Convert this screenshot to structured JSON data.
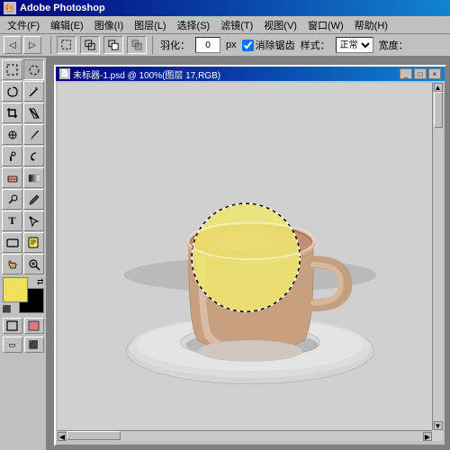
{
  "titlebar": {
    "label": "Adobe Photoshop",
    "icon": "🎨"
  },
  "menubar": {
    "items": [
      {
        "label": "文件(F)"
      },
      {
        "label": "编辑(E)"
      },
      {
        "label": "图像(I)"
      },
      {
        "label": "图层(L)"
      },
      {
        "label": "选择(S)"
      },
      {
        "label": "滤镜(T)"
      },
      {
        "label": "视图(V)"
      },
      {
        "label": "窗口(W)"
      },
      {
        "label": "帮助(H)"
      }
    ]
  },
  "optionsbar": {
    "feather_label": "羽化：",
    "feather_value": "0",
    "feather_unit": "px",
    "antialias_label": "消除锯齿",
    "style_label": "样式：",
    "style_value": "正常",
    "width_label": "宽度："
  },
  "docwindow": {
    "title": "未标器-1.psd @ 100%(图层 17,RGB)"
  },
  "tools": [
    {
      "icon": "▭",
      "name": "rectangular-marquee"
    },
    {
      "icon": "◌",
      "name": "elliptical-marquee"
    },
    {
      "icon": "⟜",
      "name": "lasso"
    },
    {
      "icon": "⊹",
      "name": "magic-wand"
    },
    {
      "icon": "✂",
      "name": "crop"
    },
    {
      "icon": "✒",
      "name": "slice"
    },
    {
      "icon": "⌫",
      "name": "healing"
    },
    {
      "icon": "🖌",
      "name": "brush"
    },
    {
      "icon": "◫",
      "name": "clone-stamp"
    },
    {
      "icon": "◩",
      "name": "history-brush"
    },
    {
      "icon": "◻",
      "name": "eraser"
    },
    {
      "icon": "🪣",
      "name": "gradient"
    },
    {
      "icon": "⬟",
      "name": "dodge"
    },
    {
      "icon": "✎",
      "name": "pen"
    },
    {
      "icon": "T",
      "name": "type"
    },
    {
      "icon": "🔲",
      "name": "path-selection"
    },
    {
      "icon": "⬡",
      "name": "shape"
    },
    {
      "icon": "🔍",
      "name": "zoom"
    },
    {
      "icon": "✋",
      "name": "hand"
    },
    {
      "icon": "🖊",
      "name": "notes"
    }
  ],
  "colors": {
    "foreground": "#f0e060",
    "background": "#000000",
    "saucer_outer": "#d8d8d8",
    "saucer_mid": "#c8c8c8",
    "cup_body": "#c8a080",
    "cup_dark": "#b08060",
    "tea_surface": "#c09070",
    "selection_fill": "#f0e870",
    "accent_blue": "#000080"
  }
}
